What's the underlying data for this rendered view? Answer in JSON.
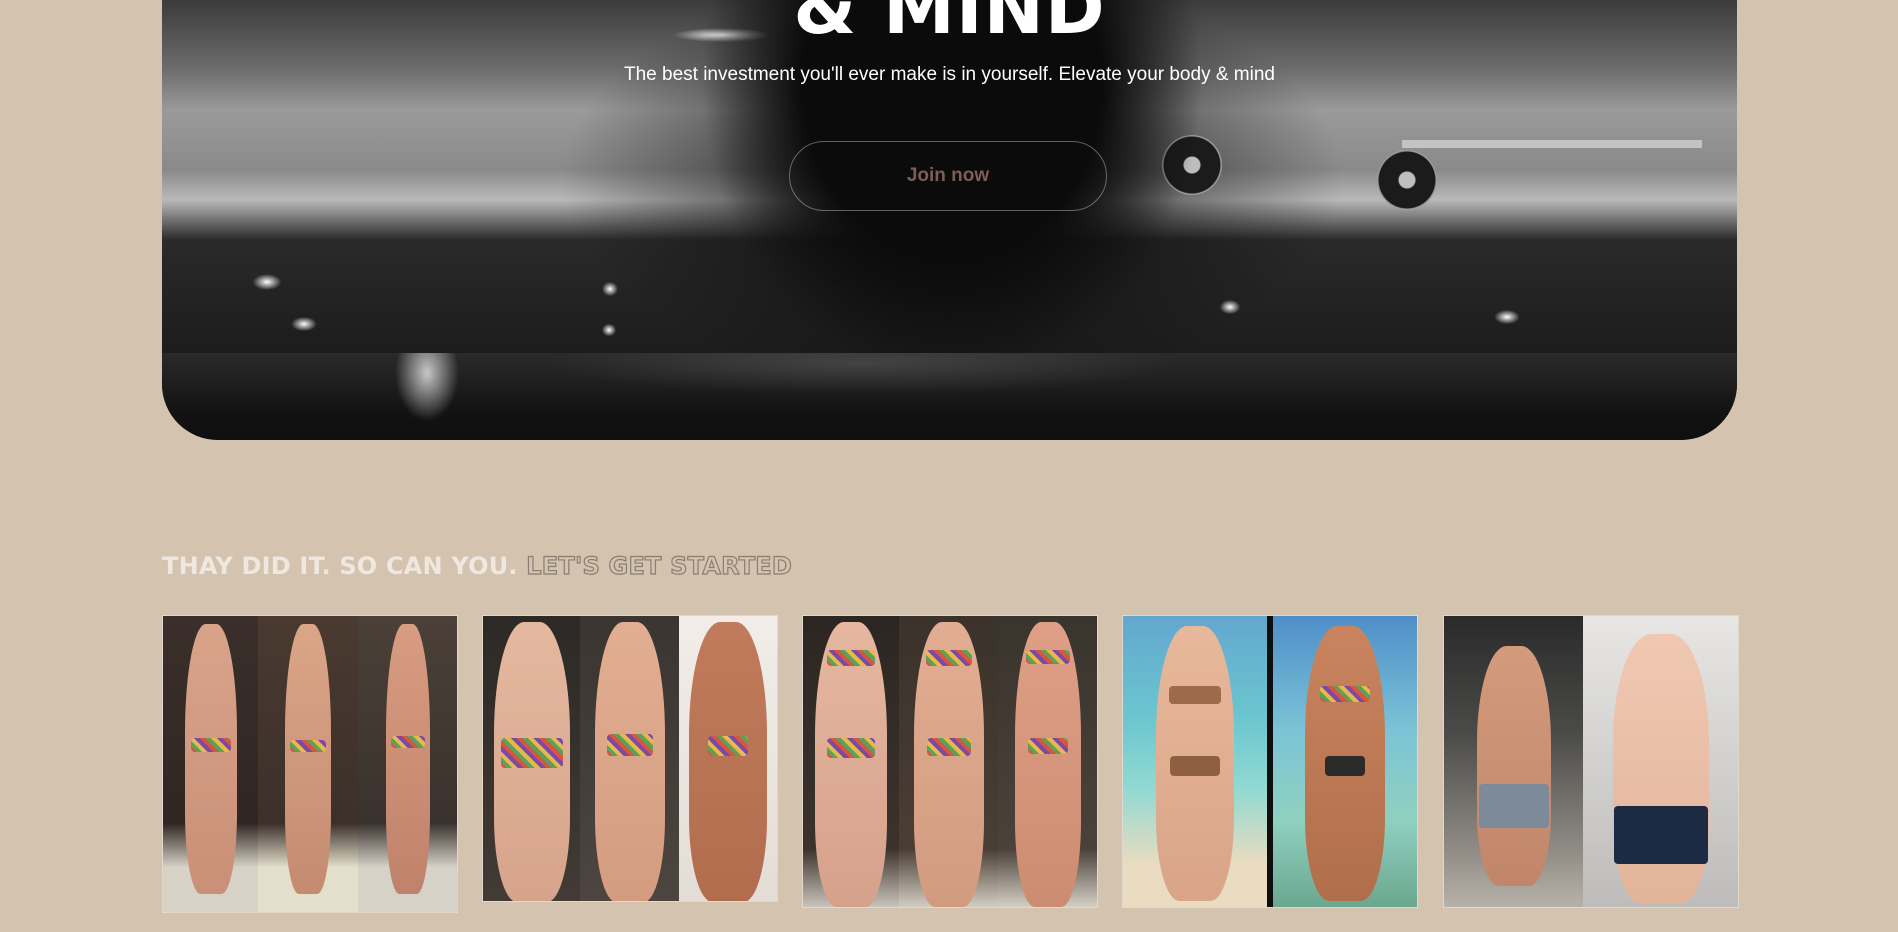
{
  "hero": {
    "heading": "& MIND",
    "subtitle": "The best investment you'll ever make is in yourself. Elevate your body & mind",
    "cta_label": "Join now"
  },
  "results": {
    "title_solid": "THAY DID IT. SO CAN YOU.",
    "title_outline": "LET'S GET STARTED",
    "images": [
      {
        "name": "transformation-side-view",
        "panels": 3
      },
      {
        "name": "transformation-back-view",
        "panels": 3
      },
      {
        "name": "transformation-front-view",
        "panels": 3
      },
      {
        "name": "transformation-beach",
        "panels": 2
      },
      {
        "name": "transformation-gym-male",
        "panels": 2
      }
    ]
  },
  "colors": {
    "page_background": "#d3c3af",
    "hero_background": "#111111",
    "cta_text": "#7c5f52",
    "title_text": "#eee8e0"
  }
}
